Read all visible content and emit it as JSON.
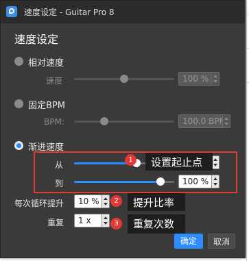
{
  "window": {
    "title": "速度设定 - Guitar Pro 8"
  },
  "dialog": {
    "heading": "速度设定"
  },
  "options": {
    "relative": {
      "label": "相对速度",
      "selected": false,
      "speed_label": "速度",
      "slider_value": 0.5,
      "value": "100 %"
    },
    "fixed": {
      "label": "固定BPM",
      "selected": false,
      "bpm_label": "BPM:",
      "slider_value": 0.3,
      "value": "100.0 BPM"
    },
    "progressive": {
      "label": "渐进速度",
      "selected": true,
      "from_label": "从",
      "from_slider_value": 0.62,
      "from_value": "",
      "to_label": "到",
      "to_slider_value": 0.86,
      "to_value": "100 %",
      "increase_label": "每次循环提升",
      "increase_value": "10 %",
      "repeat_label": "重复",
      "repeat_value": "1 x"
    }
  },
  "annotations": {
    "range_badge": "1",
    "range_callout": "设置起止点",
    "increase_badge": "2",
    "increase_callout": "提升比率",
    "repeat_badge": "3",
    "repeat_callout": "重复次数",
    "box_color": "#e53935"
  },
  "buttons": {
    "ok": "确定",
    "cancel": "取消"
  },
  "colors": {
    "accent": "#2d8cff",
    "dialog_bg": "#3a3a3a"
  }
}
